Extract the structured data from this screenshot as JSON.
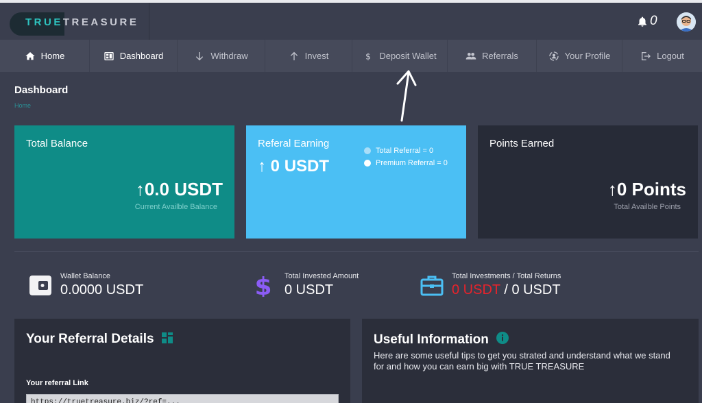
{
  "brand": {
    "part1": "TRUE",
    "part2": "TREASURE"
  },
  "header": {
    "notification_count": "0"
  },
  "nav": [
    {
      "label": "Home",
      "icon": "home-icon"
    },
    {
      "label": "Dashboard",
      "icon": "dashboard-icon"
    },
    {
      "label": "Withdraw",
      "icon": "arrow-down-icon"
    },
    {
      "label": "Invest",
      "icon": "arrow-up-icon"
    },
    {
      "label": "Deposit Wallet",
      "icon": "dollar-icon"
    },
    {
      "label": "Referrals",
      "icon": "users-icon"
    },
    {
      "label": "Your Profile",
      "icon": "profile-icon"
    },
    {
      "label": "Logout",
      "icon": "logout-icon"
    }
  ],
  "page": {
    "title": "Dashboard",
    "breadcrumb": "Home"
  },
  "cards": {
    "total_balance": {
      "title": "Total Balance",
      "value": "0.0 USDT",
      "sub": "Current Availble Balance",
      "color": "#0f8c87"
    },
    "referral": {
      "title": "Referal Earning",
      "value": "0 USDT",
      "total_referral": "Total Referral = 0",
      "premium_referral": "Premium Referral = 0",
      "color": "#4bbff4"
    },
    "points": {
      "title": "Points Earned",
      "value": "0 Points",
      "sub": "Total Availble Points",
      "color": "#272b37"
    }
  },
  "stats": {
    "wallet": {
      "label": "Wallet Balance",
      "value": "0.0000 USDT"
    },
    "invested": {
      "label": "Total Invested Amount",
      "value": "0 USDT"
    },
    "returns": {
      "label": "Total Investments / Total Returns",
      "value_invest": "0 USDT",
      "separator": " / ",
      "value_return": "0 USDT"
    }
  },
  "referral_panel": {
    "title": "Your Referral Details",
    "link_label": "Your referral Link",
    "link_value": "https://truetreasure.biz/?ref=..."
  },
  "info_panel": {
    "title": "Useful Information",
    "text": "Here are some useful tips to get you strated and understand what we stand for and how you can earn big with TRUE TREASURE"
  }
}
